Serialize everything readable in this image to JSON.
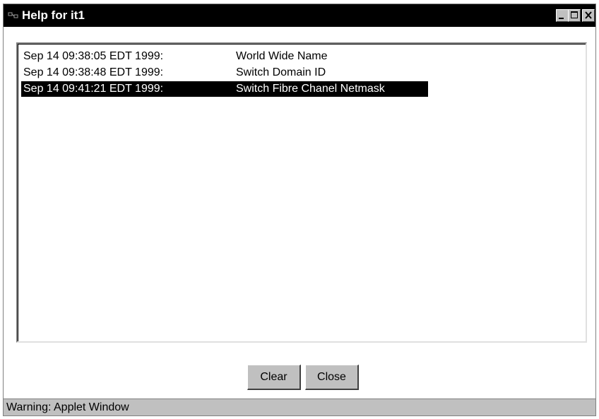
{
  "window": {
    "title": "Help for it1",
    "controls": {
      "minimize": "minimize-icon",
      "maximize": "maximize-icon",
      "close": "close-icon"
    }
  },
  "log": {
    "entries": [
      {
        "timestamp": "Sep 14 09:38:05 EDT 1999:",
        "topic": "World Wide Name",
        "selected": false
      },
      {
        "timestamp": "Sep 14 09:38:48 EDT 1999:",
        "topic": "Switch Domain ID",
        "selected": false
      },
      {
        "timestamp": "Sep 14 09:41:21 EDT 1999:",
        "topic": "Switch Fibre Chanel Netmask",
        "selected": true
      }
    ]
  },
  "buttons": {
    "clear_label": "Clear",
    "close_label": "Close"
  },
  "status": {
    "text": "Warning: Applet Window"
  },
  "colors": {
    "titlebar": "#000000",
    "chrome": "#c0c0c0",
    "selection": "#000000"
  }
}
